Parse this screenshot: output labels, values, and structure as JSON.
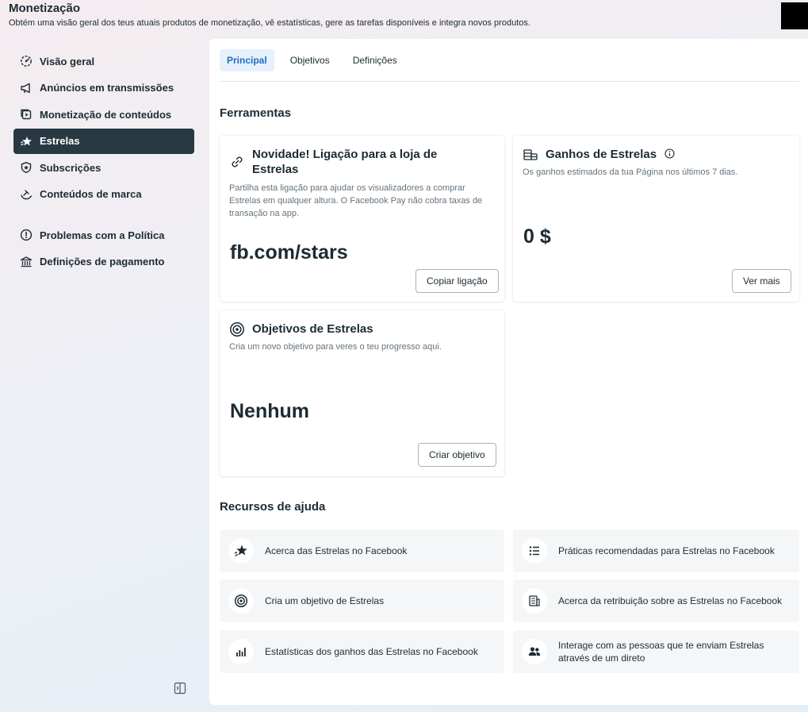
{
  "header": {
    "title": "Monetização",
    "subtitle": "Obtém uma visão geral dos teus atuais produtos de monetização, vê estatísticas, gere as tarefas disponíveis e integra novos produtos."
  },
  "sidebar": {
    "items": [
      {
        "label": "Visão geral",
        "icon": "gauge-icon"
      },
      {
        "label": "Anúncios em transmissões",
        "icon": "megaphone-icon"
      },
      {
        "label": "Monetização de conteúdos",
        "icon": "video-play-icon"
      },
      {
        "label": "Estrelas",
        "icon": "star-icon",
        "active": true
      },
      {
        "label": "Subscrições",
        "icon": "shield-star-icon"
      },
      {
        "label": "Conteúdos de marca",
        "icon": "handshake-icon"
      },
      {
        "label": "Problemas com a Política",
        "icon": "alert-circle-icon"
      },
      {
        "label": "Definições de pagamento",
        "icon": "bank-icon"
      }
    ]
  },
  "tabs": [
    "Principal",
    "Objetivos",
    "Definições"
  ],
  "sections": {
    "tools": "Ferramentas",
    "help": "Recursos de ajuda"
  },
  "cards": {
    "link": {
      "title": "Novidade! Ligação para a loja de Estrelas",
      "desc": "Partilha esta ligação para ajudar os visualizadores a comprar Estrelas em qualquer altura. O Facebook Pay não cobra taxas de transação na app.",
      "value": "fb.com/stars",
      "button": "Copiar ligação"
    },
    "earnings": {
      "title": "Ganhos de Estrelas",
      "desc": "Os ganhos estimados da tua Página nos últimos 7 dias.",
      "value": "0 $",
      "button": "Ver mais"
    },
    "goals": {
      "title": "Objetivos de Estrelas",
      "desc": "Cria um novo objetivo para veres o teu progresso aqui.",
      "value": "Nenhum",
      "button": "Criar objetivo"
    }
  },
  "help_items": [
    {
      "label": "Acerca das Estrelas no Facebook",
      "icon": "star-icon"
    },
    {
      "label": "Práticas recomendadas para Estrelas no Facebook",
      "icon": "list-icon"
    },
    {
      "label": "Cria um objetivo de Estrelas",
      "icon": "target-icon"
    },
    {
      "label": "Acerca da retribuição sobre as Estrelas no Facebook",
      "icon": "ledger-icon"
    },
    {
      "label": "Estatísticas dos ganhos das Estrelas no Facebook",
      "icon": "bar-chart-icon"
    },
    {
      "label": "Interage com as pessoas que te enviam Estrelas através de um direto",
      "icon": "people-icon"
    }
  ],
  "colors": {
    "accent": "#1f6fbf",
    "active_nav": "#283943",
    "text": "#1c2b33"
  }
}
